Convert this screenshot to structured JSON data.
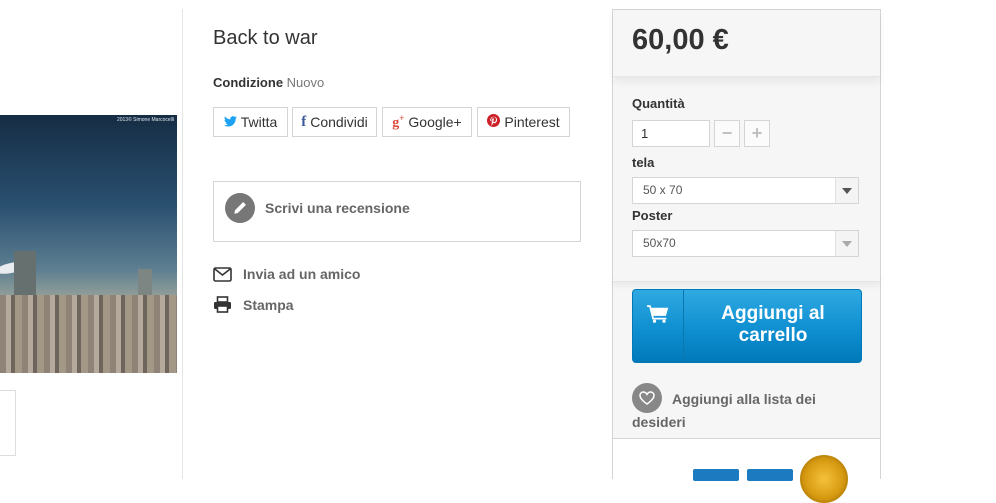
{
  "image": {
    "credit": "2013© Simone Marcocelli"
  },
  "product": {
    "title": "Back to war",
    "condition_label": "Condizione",
    "condition_value": "Nuovo"
  },
  "share": [
    {
      "label": "Twitta",
      "icon": "twitter-icon",
      "color": "#1da1f2"
    },
    {
      "label": "Condividi",
      "icon": "facebook-icon",
      "color": "#3b5998"
    },
    {
      "label": "Google+",
      "icon": "google-plus-icon",
      "color": "#dd4b39"
    },
    {
      "label": "Pinterest",
      "icon": "pinterest-icon",
      "color": "#cb2027"
    }
  ],
  "review": {
    "label": "Scrivi una recensione",
    "icon": "pencil-icon"
  },
  "links": {
    "send_friend": "Invia ad un amico",
    "print": "Stampa"
  },
  "buy": {
    "price": "60,00 €",
    "quantity_label": "Quantità",
    "quantity_value": "1",
    "tela_label": "tela",
    "tela_value": "50 x 70",
    "poster_label": "Poster",
    "poster_value": "50x70",
    "cart_label": "Aggiungi al carrello",
    "wishlist_label": "Aggiungi alla lista dei desideri",
    "accent": "#0f8fd1"
  }
}
